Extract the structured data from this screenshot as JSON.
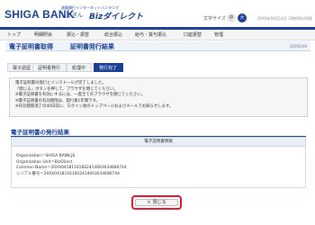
{
  "header": {
    "brand": "SHIGA BANK",
    "brand_sub": "滋賀銀行インターネットバンキング",
    "brand_name": "しがぎん",
    "brand_biz": "Bizダイレクト",
    "font_size_label": "文字サイズ",
    "font_small": "中",
    "font_large": "大",
    "timestamp": "20XX年04月14日 15時00分00秒"
  },
  "nav": {
    "items": [
      "トップ",
      "明細照会",
      "振込・振替",
      "総合振込",
      "給与・賞与振込",
      "口座振替",
      "管理"
    ]
  },
  "titlebar": {
    "title": "電子証明書取得",
    "subtitle": "証明書発行結果",
    "screen_id": "BSMS008"
  },
  "steps": [
    "電子認証",
    "証明書発行",
    "処理中",
    "発行完了"
  ],
  "message": {
    "lines": [
      "電子証明書の発行とインストールが完了しました。",
      "「閉じる」ボタンを押して、ブラウザを閉じてください。",
      "※電子証明書を有効にするには、一度全てのブラウザを閉じてください。",
      "※電子証明書の有効期限は、発行後1年間です。",
      "※有効期限満了の40日前に、ログイン後のトップページおよびメールでお知らせします。"
    ]
  },
  "section": {
    "title": "電子証明書の発行結果",
    "table_header": "電子証明書情報",
    "lines": [
      "Organization＝SHIGA BANK,JS",
      "Organization Unit＝BizDirect",
      "Common Name＝20XX04181161602414003034686744",
      "シリアル番号＝20XX04181161602414003034686744"
    ]
  },
  "close_button": {
    "icon": "×",
    "label": "閉じる"
  },
  "colors": {
    "brand_blue": "#1a3f95",
    "highlight_red": "#e0192a"
  }
}
